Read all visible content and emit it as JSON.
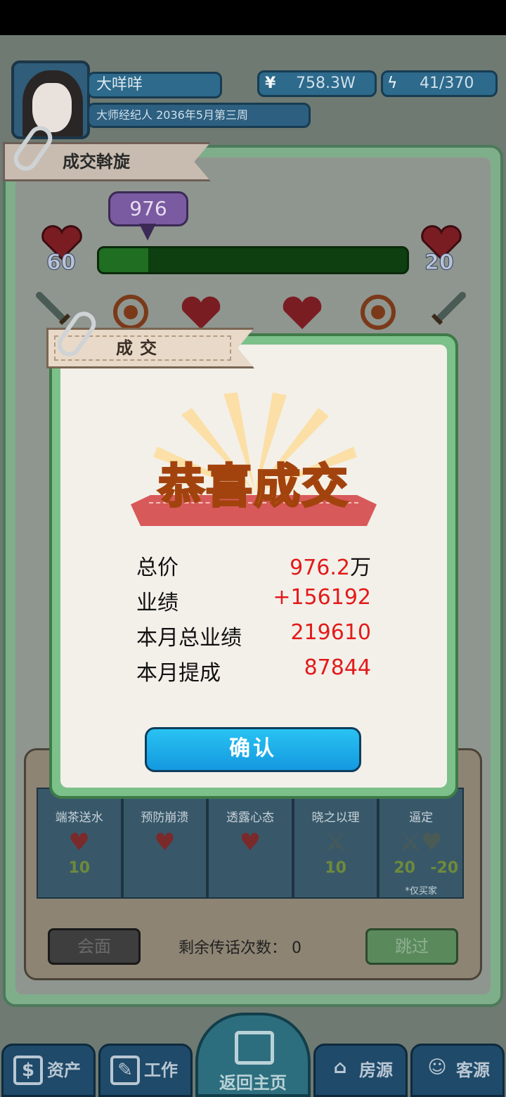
{
  "header": {
    "player_name": "大咩咩",
    "player_title": "大师经纪人 2036年5月第三周",
    "money_symbol": "¥",
    "money_value": "758.3W",
    "energy_symbol": "ϟ",
    "energy_value": "41/370"
  },
  "negotiation": {
    "ribbon_label": "成交斡旋",
    "bubble_value": "976",
    "progress_fraction": 0.16,
    "left_heart_value": "60",
    "right_heart_value": "20"
  },
  "actions": [
    {
      "label": "端茶送水",
      "value": "10"
    },
    {
      "label": "预防崩溃",
      "value": ""
    },
    {
      "label": "透露心态",
      "value": ""
    },
    {
      "label": "晓之以理",
      "value": "10"
    },
    {
      "label": "逼定",
      "value": "20",
      "value2": "-20",
      "note": "*仅买家"
    }
  ],
  "bottom_controls": {
    "meet_label": "会面",
    "remain_label": "剩余传话次数：",
    "remain_value": "0",
    "skip_label": "跳过"
  },
  "modal": {
    "ribbon_label": "成交",
    "headline": "恭喜成交",
    "rows": [
      {
        "key": "总价",
        "value": "976.2",
        "unit": "万"
      },
      {
        "key": "业绩",
        "value": "+156192"
      },
      {
        "key": "本月总业绩",
        "value": "219610"
      },
      {
        "key": "本月提成",
        "value": "87844"
      }
    ],
    "confirm_label": "确认"
  },
  "nav": {
    "assets": "资产",
    "work": "工作",
    "home": "返回主页",
    "houses": "房源",
    "clients": "客源"
  },
  "colors": {
    "modal_value_red": "#e31a1a",
    "confirm_blue": "#1499e0",
    "headline_gold": "#ffcf3a"
  }
}
